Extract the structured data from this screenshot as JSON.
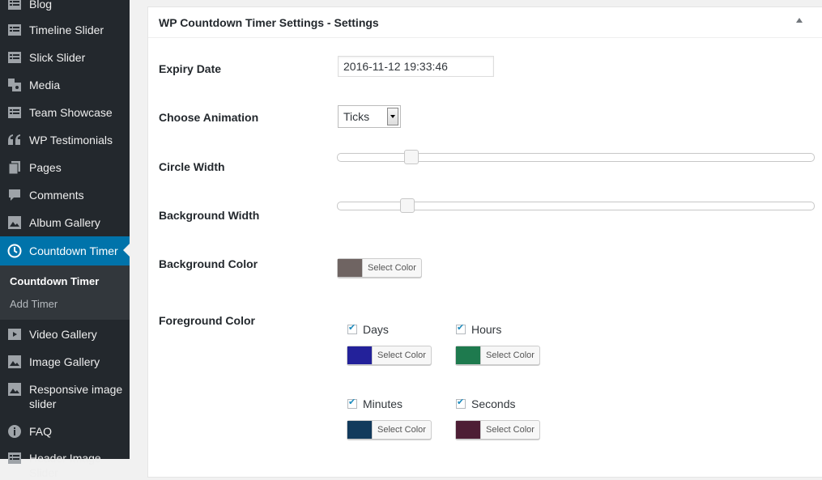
{
  "sidebar": {
    "items": [
      {
        "label": "Blog",
        "icon": "list-icon"
      },
      {
        "label": "Timeline Slider",
        "icon": "list-icon"
      },
      {
        "label": "Slick Slider",
        "icon": "list-icon"
      },
      {
        "label": "Media",
        "icon": "media-icon"
      },
      {
        "label": "Team Showcase",
        "icon": "list-icon"
      },
      {
        "label": "WP Testimonials",
        "icon": "quote-icon"
      },
      {
        "label": "Pages",
        "icon": "pages-icon"
      },
      {
        "label": "Comments",
        "icon": "comment-icon"
      },
      {
        "label": "Album Gallery",
        "icon": "gallery-icon"
      },
      {
        "label": "Countdown Timer",
        "icon": "clock-icon"
      },
      {
        "label": "Video Gallery",
        "icon": "video-icon"
      },
      {
        "label": "Image Gallery",
        "icon": "gallery-icon"
      },
      {
        "label": "Responsive image slider",
        "icon": "gallery-icon"
      },
      {
        "label": "FAQ",
        "icon": "info-icon"
      },
      {
        "label": "Header Image Slider",
        "icon": "list-icon"
      }
    ],
    "submenu": [
      {
        "label": "Countdown Timer",
        "current": true
      },
      {
        "label": "Add Timer",
        "current": false
      }
    ]
  },
  "panel": {
    "title": "WP Countdown Timer Settings - Settings",
    "fields": {
      "expiry_label": "Expiry Date",
      "expiry_value": "2016-11-12 19:33:46",
      "animation_label": "Choose Animation",
      "animation_value": "Ticks",
      "circle_width_label": "Circle Width",
      "circle_width_fraction": 0.155,
      "background_width_label": "Background Width",
      "background_width_fraction": 0.147,
      "background_color_label": "Background Color",
      "background_color": "#6f6462",
      "foreground_color_label": "Foreground Color"
    },
    "select_color_label": "Select Color",
    "foreground": [
      {
        "label": "Days",
        "checked": true,
        "color": "#23219a"
      },
      {
        "label": "Hours",
        "checked": true,
        "color": "#1e7a4e"
      },
      {
        "label": "Minutes",
        "checked": true,
        "color": "#123a5c"
      },
      {
        "label": "Seconds",
        "checked": true,
        "color": "#4d1e35"
      }
    ]
  }
}
